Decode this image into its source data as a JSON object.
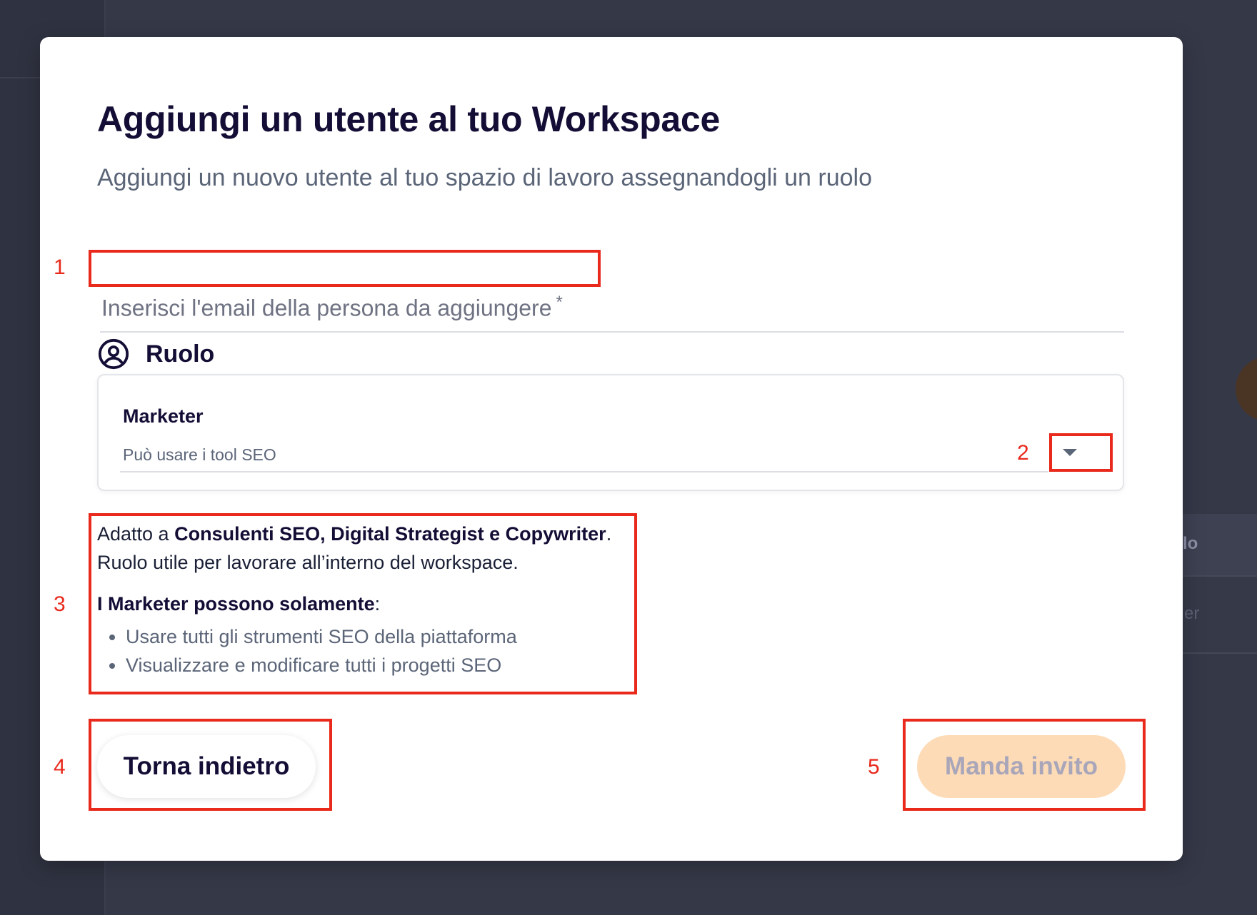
{
  "background": {
    "partial_label": "lo",
    "partial_text": "er"
  },
  "modal": {
    "title": "Aggiungi un utente al tuo Workspace",
    "subtitle": "Aggiungi un nuovo utente al tuo spazio di lavoro assegnandogli un ruolo",
    "email_field": {
      "label": "Inserisci l'email della persona da aggiungere",
      "required_marker": "*",
      "value": ""
    },
    "role_section": {
      "title": "Ruolo",
      "icon": "user-circle-icon",
      "selected_role": {
        "name": "Marketer",
        "description": "Può usare i tool SEO"
      },
      "dropdown_icon": "caret-down-icon"
    },
    "role_info": {
      "line1_prefix": "Adatto a ",
      "line1_bold": "Consulenti SEO, Digital Strategist e Copywriter",
      "line1_suffix": ".",
      "line2": "Ruolo utile per lavorare all’interno del workspace.",
      "permissions_bold": "I Marketer possono solamente",
      "permissions_suffix": ":",
      "permissions": [
        "Usare tutti gli strumenti SEO della piattaforma",
        "Visualizzare e modificare tutti i progetti SEO"
      ]
    },
    "buttons": {
      "back": "Torna indietro",
      "send": "Manda invito"
    }
  },
  "annotations": [
    "1",
    "2",
    "3",
    "4",
    "5"
  ],
  "colors": {
    "annotation": "#e8291c",
    "title": "#140d35",
    "muted": "#5b6578",
    "send_disabled_bg": "#fddbb6"
  }
}
